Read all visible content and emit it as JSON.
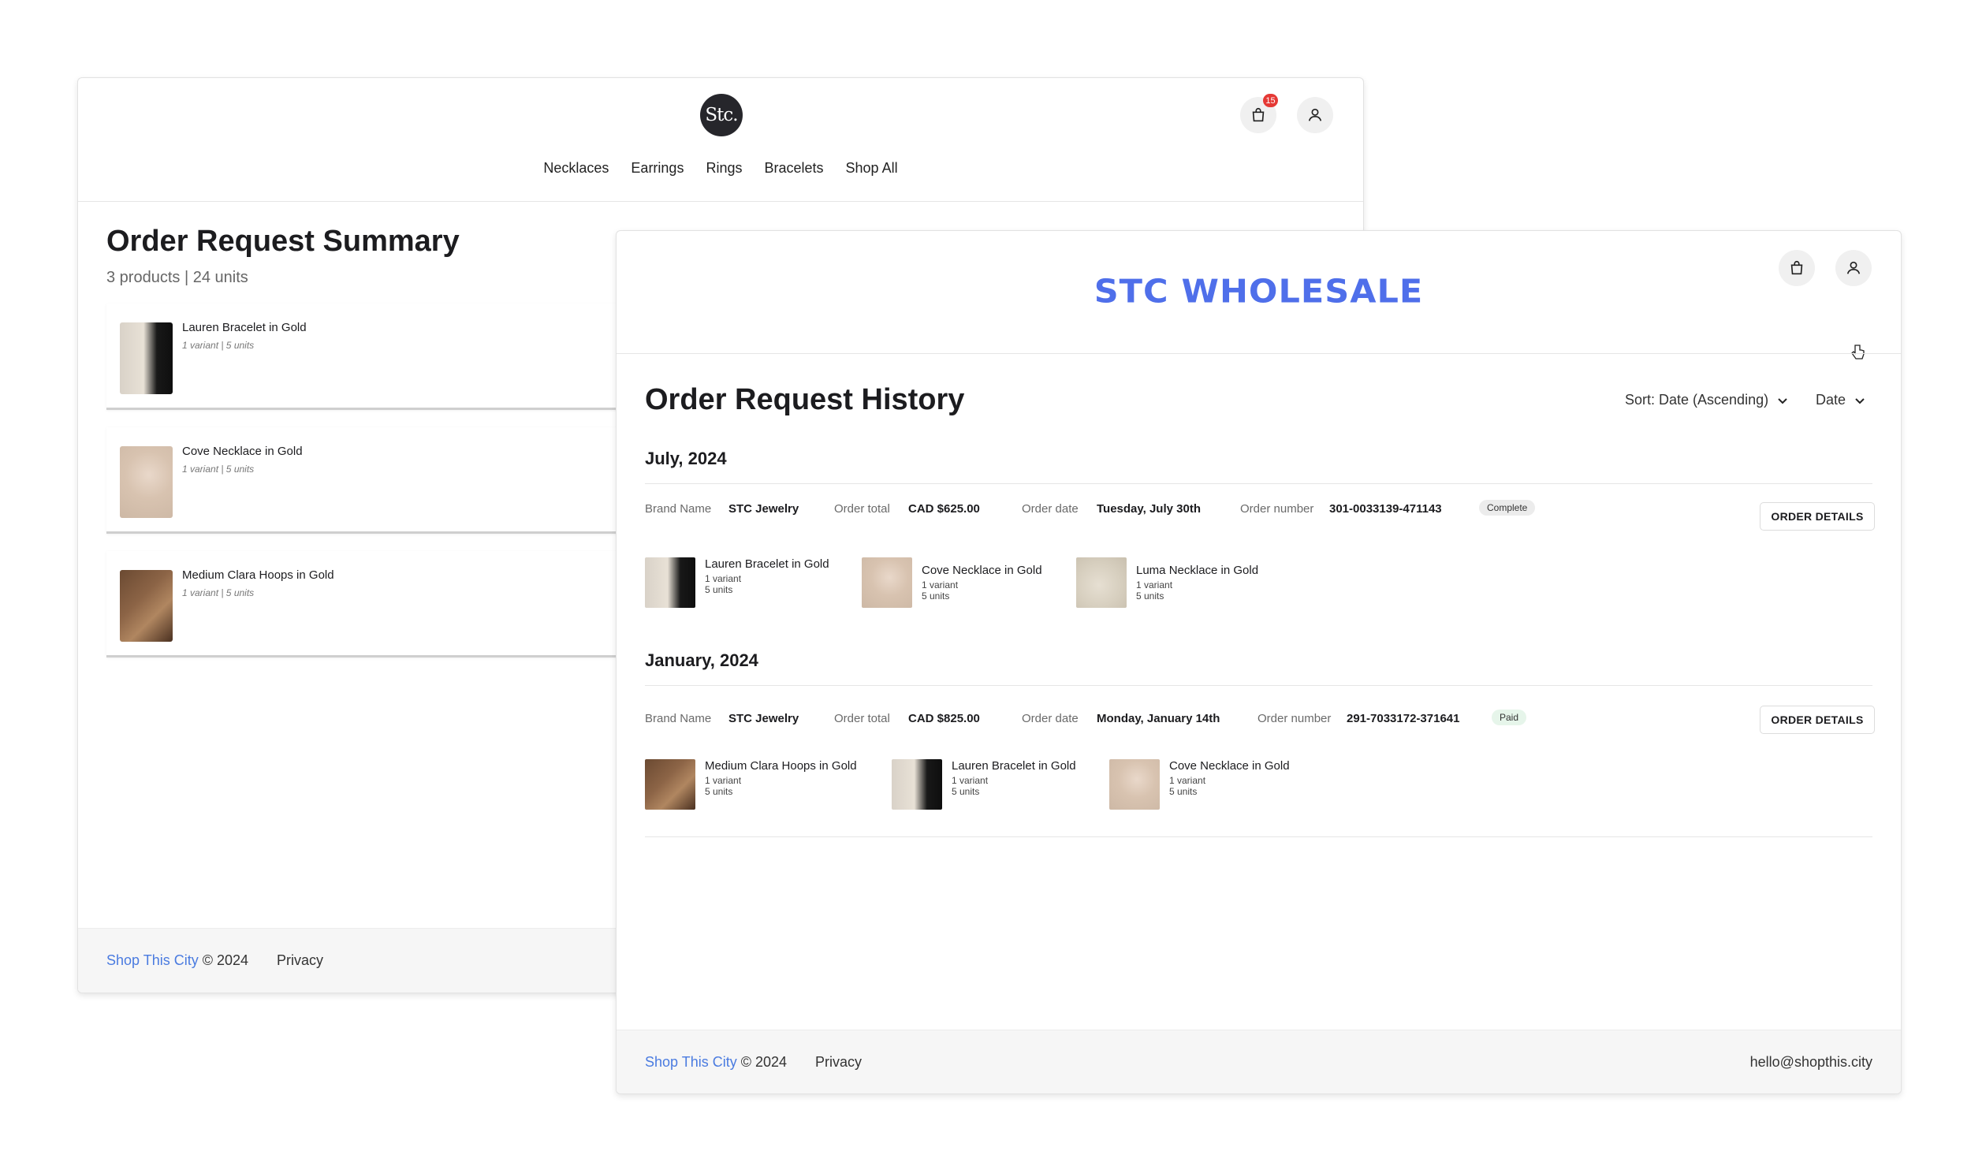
{
  "back_window": {
    "logo": "Stc.",
    "cart_count": "15",
    "nav": [
      "Necklaces",
      "Earrings",
      "Rings",
      "Bracelets",
      "Shop All"
    ],
    "title": "Order Request Summary",
    "subtitle": "3 products | 24 units",
    "products": [
      {
        "name": "Lauren Bracelet in Gold",
        "meta": "1 variant | 5 units",
        "image": "bracelet"
      },
      {
        "name": "Cove Necklace in Gold",
        "meta": "1 variant | 5 units",
        "image": "necklace"
      },
      {
        "name": "Medium Clara Hoops in Gold",
        "meta": "1 variant | 5 units",
        "image": "hoops"
      }
    ],
    "footer": {
      "brand": "Shop This City",
      "copyright": " © 2024",
      "privacy": "Privacy"
    }
  },
  "front_window": {
    "logo": "STC WHOLESALE",
    "title": "Order Request History",
    "sort_label": "Sort: Date (Ascending)",
    "date_filter": "Date",
    "groups": [
      {
        "month": "July, 2024",
        "labels": {
          "brand": "Brand Name",
          "total": "Order total",
          "date": "Order date",
          "number": "Order number"
        },
        "brand": "STC Jewelry",
        "total": "CAD $625.00",
        "date": "Tuesday, July 30th",
        "number": "301-0033139-471143",
        "status": "Complete",
        "button": "ORDER DETAILS",
        "items": [
          {
            "name": "Lauren Bracelet in Gold",
            "variant": "1 variant",
            "units": "5 units"
          },
          {
            "name": "Cove Necklace in Gold",
            "variant": "1 variant",
            "units": "5 units"
          },
          {
            "name": "Luma Necklace in Gold",
            "variant": "1 variant",
            "units": "5 units"
          }
        ]
      },
      {
        "month": "January, 2024",
        "labels": {
          "brand": "Brand Name",
          "total": "Order total",
          "date": "Order date",
          "number": "Order number"
        },
        "brand": "STC Jewelry",
        "total": "CAD $825.00",
        "date": "Monday, January 14th",
        "number": "291-7033172-371641",
        "status": "Paid",
        "button": "ORDER DETAILS",
        "items": [
          {
            "name": "Medium Clara Hoops in Gold",
            "variant": "1 variant",
            "units": "5 units"
          },
          {
            "name": "Lauren Bracelet in Gold",
            "variant": "1 variant",
            "units": "5 units"
          },
          {
            "name": "Cove Necklace in Gold",
            "variant": "1 variant",
            "units": "5 units"
          }
        ]
      }
    ],
    "footer": {
      "brand": "Shop This City",
      "copyright": " © 2024",
      "privacy": "Privacy",
      "email": "hello@shopthis.city"
    }
  },
  "colors": {
    "accent_blue": "#4f6fea",
    "link_blue": "#4a7be0",
    "badge_red": "#e53935",
    "complete_bg": "#ececec",
    "paid_bg": "#e6f5ea"
  }
}
